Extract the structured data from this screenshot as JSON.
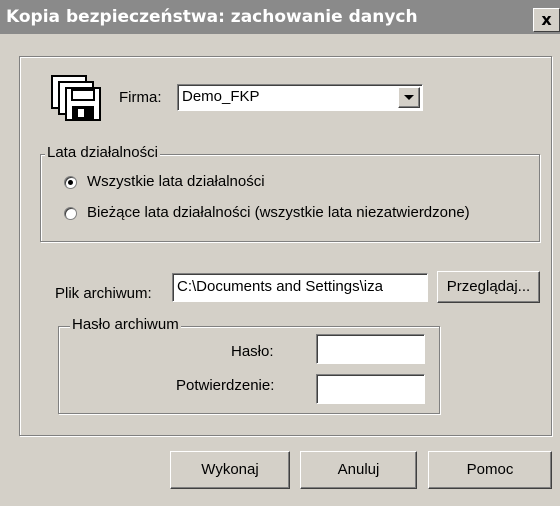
{
  "window": {
    "title": "Kopia bezpieczeństwa: zachowanie danych",
    "close_label": "x"
  },
  "company": {
    "label": "Firma:",
    "selected": "Demo_FKP"
  },
  "years_group": {
    "legend": "Lata działalności",
    "options": [
      {
        "label": "Wszystkie lata działalności",
        "selected": true
      },
      {
        "label": "Bieżące lata działalności (wszystkie lata niezatwierdzone)",
        "selected": false
      }
    ]
  },
  "archive": {
    "label": "Plik archiwum:",
    "path": "C:\\Documents and Settings\\iza",
    "browse_label": "Przeglądaj..."
  },
  "password_group": {
    "legend": "Hasło archiwum",
    "password_label": "Hasło:",
    "password_value": "",
    "confirm_label": "Potwierdzenie:",
    "confirm_value": ""
  },
  "buttons": {
    "execute": "Wykonaj",
    "cancel": "Anuluj",
    "help": "Pomoc"
  },
  "icon": "floppy-disks-icon"
}
